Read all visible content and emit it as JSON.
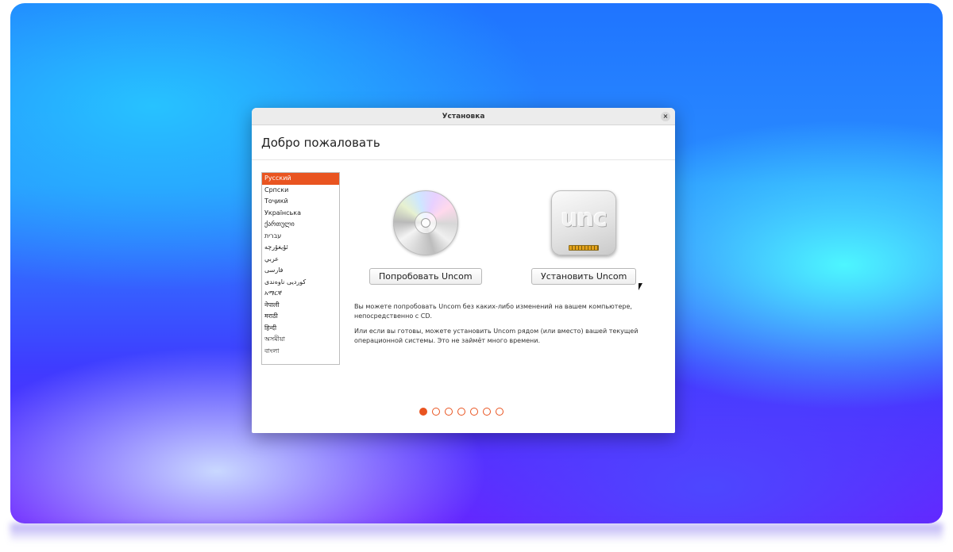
{
  "window": {
    "title": "Установка",
    "close_symbol": "×"
  },
  "header": {
    "title": "Добро пожаловать"
  },
  "languages": [
    {
      "label": "Русский",
      "selected": true
    },
    {
      "label": "Српски",
      "selected": false
    },
    {
      "label": "Тоҷикӣ",
      "selected": false
    },
    {
      "label": "Українська",
      "selected": false
    },
    {
      "label": "ქართული",
      "selected": false
    },
    {
      "label": "עברית",
      "selected": false
    },
    {
      "label": "ئۇيغۇرچە",
      "selected": false
    },
    {
      "label": "عربي",
      "selected": false
    },
    {
      "label": "فارسی",
      "selected": false
    },
    {
      "label": "کوردیی ناوەندی",
      "selected": false
    },
    {
      "label": "አማርኛ",
      "selected": false
    },
    {
      "label": "नेपाली",
      "selected": false
    },
    {
      "label": "मराठी",
      "selected": false
    },
    {
      "label": "हिन्दी",
      "selected": false
    },
    {
      "label": "অসমীয়া",
      "selected": false
    },
    {
      "label": "বাংলা",
      "selected": false
    }
  ],
  "options": {
    "try": {
      "label": "Попробовать Uncom",
      "icon": "cd-disc-icon"
    },
    "install": {
      "label": "Установить Uncom",
      "icon": "uncom-drive-icon",
      "logo_text": "unc"
    }
  },
  "description": {
    "line1": "Вы можете попробовать Uncom без каких-либо изменений на вашем компьютере, непосредственно с CD.",
    "line2": "Или если вы готовы, можете установить Uncom рядом (или вместо) вашей текущей операционной системы. Это не займёт много времени."
  },
  "progress": {
    "total_steps": 7,
    "current_step": 1
  },
  "colors": {
    "accent": "#e95420"
  }
}
